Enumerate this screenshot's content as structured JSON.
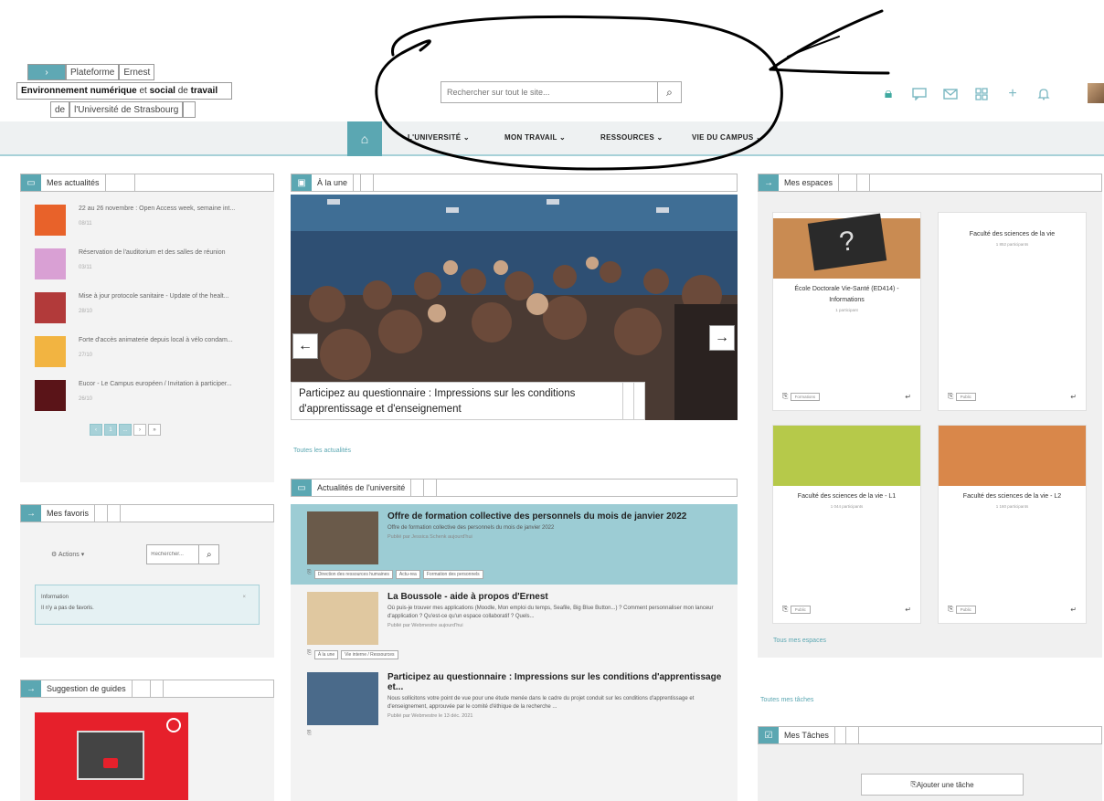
{
  "brand": {
    "icon": "›",
    "word1": "Plateforme",
    "word2": "Ernest",
    "line2_bold1": "Environnement numérique",
    "line2_mid": " et ",
    "line2_bold2": "social",
    "line2_mid2": " de ",
    "line2_bold3": "travail",
    "line3_a": "de",
    "line3_b": "l'Université de Strasbourg"
  },
  "search": {
    "placeholder": "Rechercher sur tout le site..."
  },
  "toolbar": {
    "icons": [
      "lock-icon",
      "chat-icon",
      "mail-icon",
      "apps-icon",
      "plus-icon",
      "bell-icon"
    ]
  },
  "nav": {
    "items": [
      "L'UNIVERSITÉ ⌄",
      "MON TRAVAIL ⌄",
      "RESSOURCES ⌄",
      "VIE DU CAMPUS ⌄"
    ]
  },
  "mes_actualites": {
    "title": "Mes actualités",
    "items": [
      {
        "text": "22 au 26 novembre : Open Access week, semaine int...",
        "date": "08/11",
        "color": "#e8622a"
      },
      {
        "text": "Réservation de l'auditorium et des salles de réunion",
        "date": "03/11",
        "color": "#d9a0d4"
      },
      {
        "text": "Mise à jour protocole sanitaire - Update of the healt...",
        "date": "28/10",
        "color": "#b23a3a"
      },
      {
        "text": "Forte d'accès animaterie depuis local à vélo condam...",
        "date": "27/10",
        "color": "#f2b441"
      },
      {
        "text": "Eucor - Le Campus européen / Invitation à participer...",
        "date": "26/10",
        "color": "#5a1418"
      }
    ],
    "pager": [
      "‹",
      "1",
      "...",
      "›",
      "»"
    ]
  },
  "mes_favoris": {
    "title": "Mes favoris",
    "actions_label": "Actions ▾",
    "search_placeholder": "Rechercher...",
    "info_title": "Information",
    "info_text": "Il n'y a pas de favoris."
  },
  "suggestion": {
    "title": "Suggestion de guides"
  },
  "a_la_une": {
    "title": "À la une",
    "caption": "Participez au questionnaire : Impressions sur les conditions d'apprentissage et d'enseignement",
    "prev": "←",
    "next": "→",
    "all_link": "Toutes les actualités"
  },
  "actualites_universite": {
    "title": "Actualités de l'université",
    "items": [
      {
        "title": "Offre de formation collective des personnels du mois de janvier 2022",
        "desc": "Offre de formation collective des personnels du mois de janvier 2022",
        "meta": "Publié par Jessica Schenk aujourd'hui",
        "tags": [
          "Direction des ressources humaines",
          "Actu-rea",
          "Formation des personnels"
        ]
      },
      {
        "title": "La Boussole - aide à propos d'Ernest",
        "desc": "Où puis-je trouver mes applications (Moodle, Mon emploi du temps, Seafile, Big Blue Button...) ? Comment personnaliser mon lanceur d'application ? Qu'est-ce qu'un espace collaboratif ? Quels...",
        "meta": "Publié par Webmestre aujourd'hui",
        "tags": [
          "À la une",
          "Vie interne / Ressources"
        ]
      },
      {
        "title": "Participez au questionnaire : Impressions sur les conditions d'apprentissage et...",
        "desc": "Nous sollicitons votre point de vue pour une étude menée dans le cadre du projet conduit sur les conditions d'apprentissage et d'enseignement, approuvée par le comité d'éthique de la recherche ...",
        "meta": "Publié par Webmestre le 13 déc. 2021",
        "tags": []
      }
    ]
  },
  "mes_espaces": {
    "title": "Mes espaces",
    "cards": [
      {
        "title": "École Doctorale Vie-Santé (ED414) - Informations",
        "sub": "1 participant",
        "tag": "Formations",
        "color": "#c98b52"
      },
      {
        "title": "Faculté des sciences de la vie",
        "sub": "1 852 participants",
        "tag": "Public",
        "color": "#ffffff"
      },
      {
        "title": "Faculté des sciences de la vie - L1",
        "sub": "1 044 participants",
        "tag": "Public",
        "color": "#b6c94a"
      },
      {
        "title": "Faculté des sciences de la vie - L2",
        "sub": "1 160 participants",
        "tag": "Public",
        "color": "#d9874a"
      }
    ],
    "all_link": "Tous mes espaces"
  },
  "taches": {
    "all_link": "Toutes mes tâches",
    "title": "Mes Tâches",
    "add_label": "Ajouter une tâche"
  },
  "colors": {
    "accent": "#5ba7b2",
    "accent_light": "#9cccd4"
  }
}
